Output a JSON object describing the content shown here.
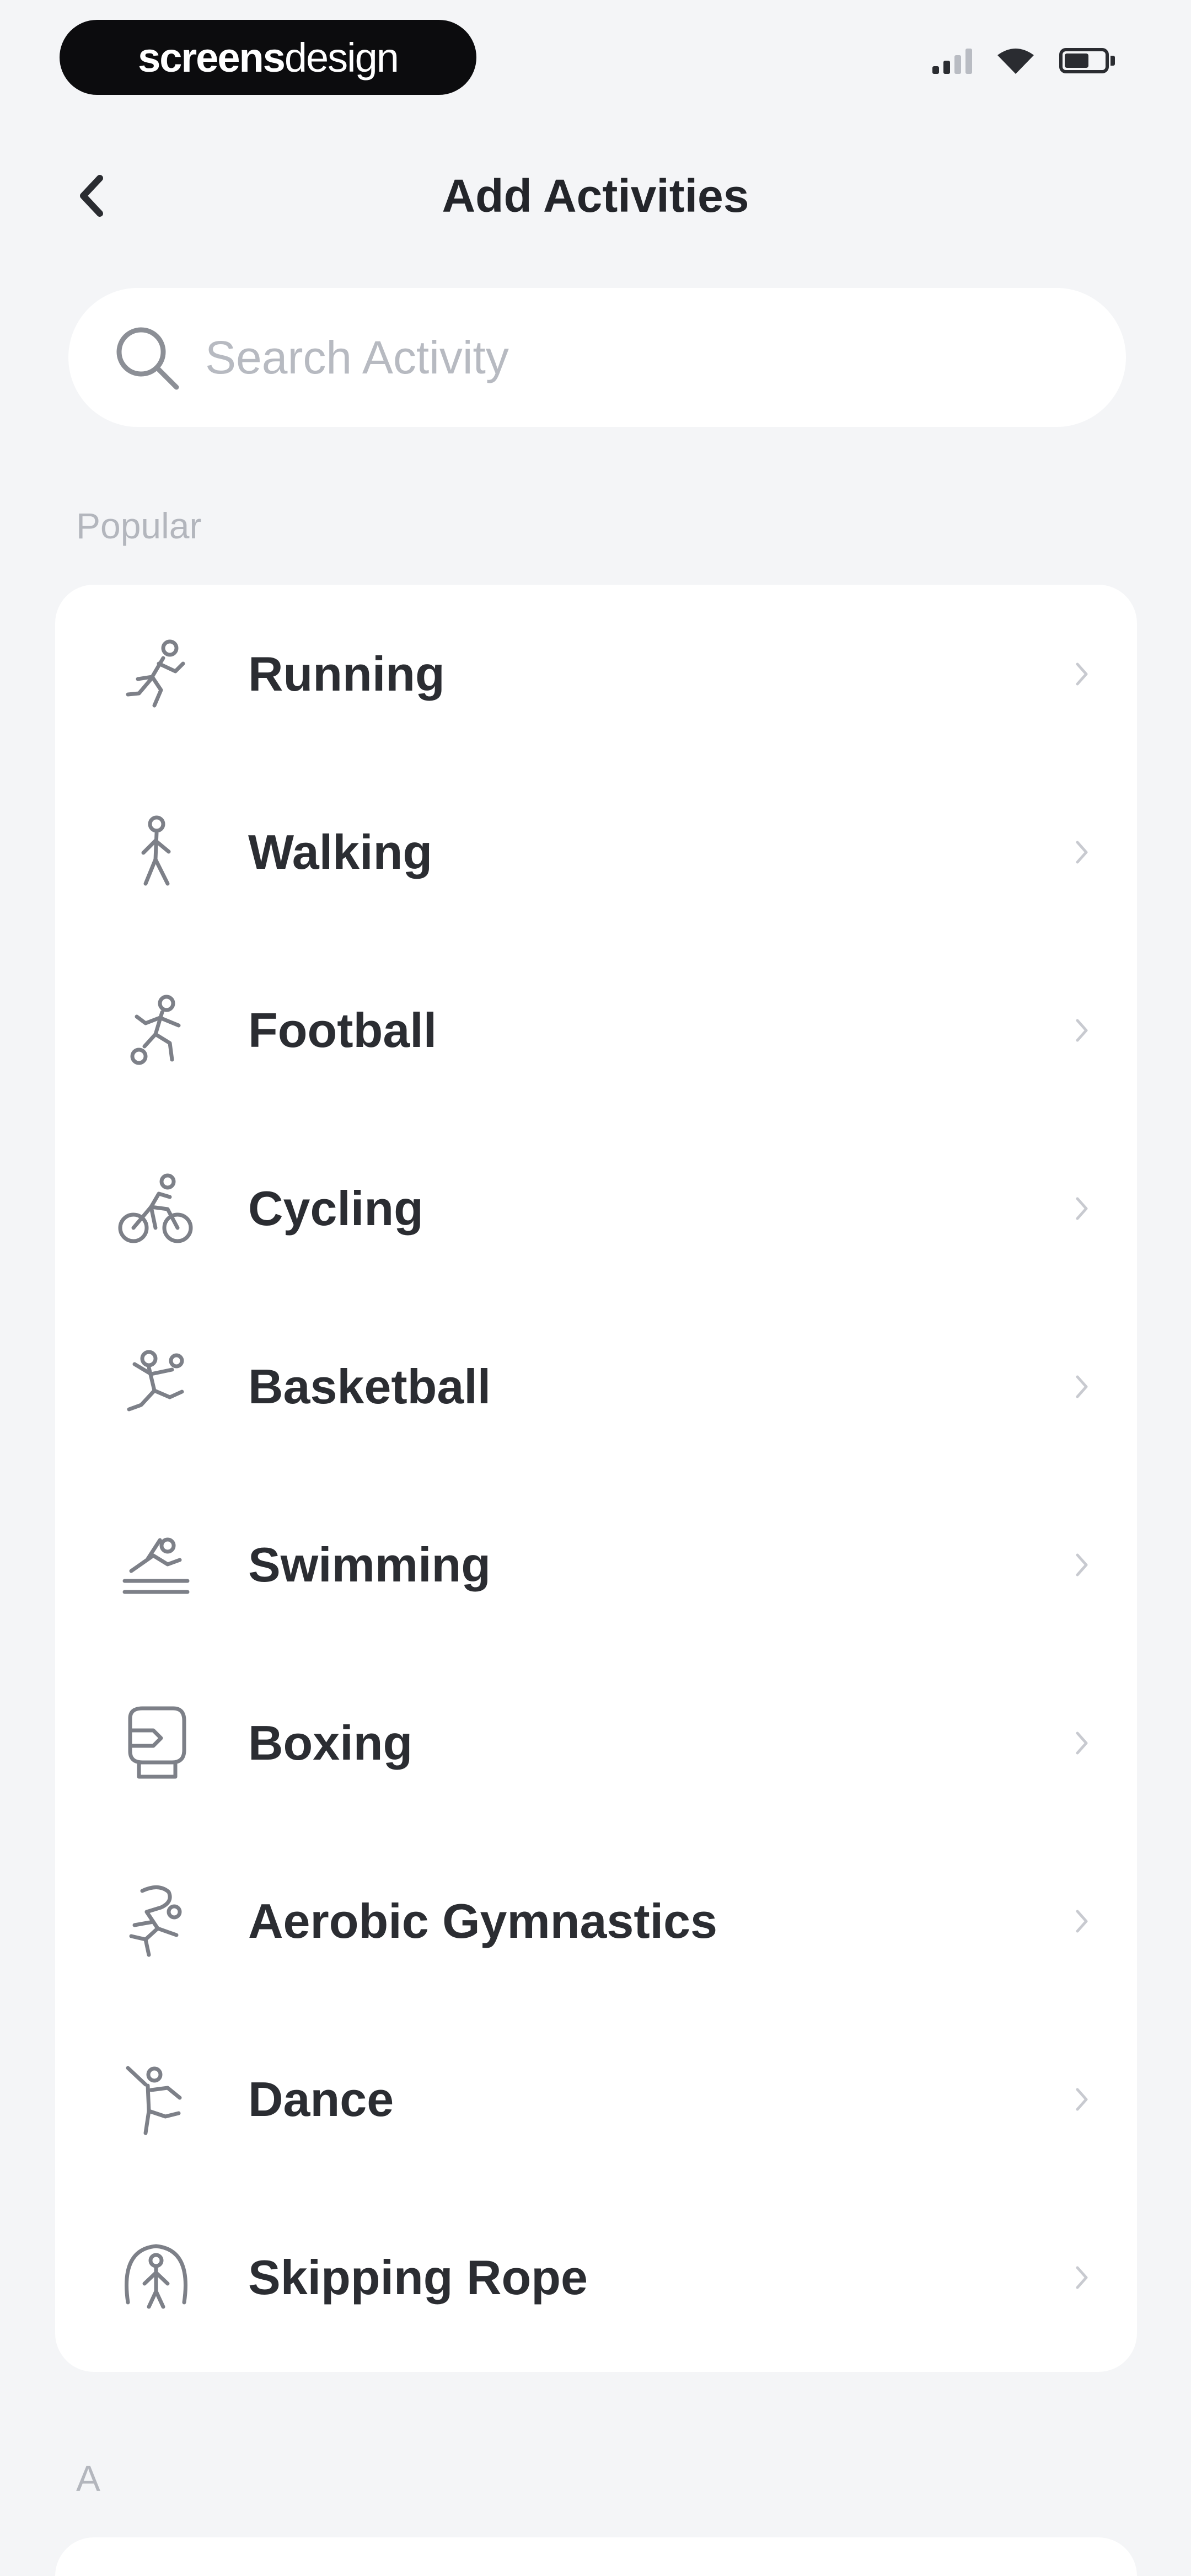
{
  "status_bar": {
    "brand_bold": "screens",
    "brand_light": "design"
  },
  "header": {
    "title": "Add Activities"
  },
  "search": {
    "placeholder": "Search Activity",
    "value": ""
  },
  "sections": {
    "popular_label": "Popular",
    "a_label": "A"
  },
  "activities": [
    {
      "label": "Running",
      "icon": "running-icon"
    },
    {
      "label": "Walking",
      "icon": "walking-icon"
    },
    {
      "label": "Football",
      "icon": "football-icon"
    },
    {
      "label": "Cycling",
      "icon": "cycling-icon"
    },
    {
      "label": "Basketball",
      "icon": "basketball-icon"
    },
    {
      "label": "Swimming",
      "icon": "swimming-icon"
    },
    {
      "label": "Boxing",
      "icon": "boxing-icon"
    },
    {
      "label": "Aerobic Gymnastics",
      "icon": "aerobic-gymnastics-icon"
    },
    {
      "label": "Dance",
      "icon": "dance-icon"
    },
    {
      "label": "Skipping Rope",
      "icon": "skipping-rope-icon"
    }
  ],
  "colors": {
    "background": "#f4f5f7",
    "card": "#ffffff",
    "text": "#2b2d32",
    "muted": "#b3b6bd",
    "icon_stroke": "#7d8088"
  }
}
